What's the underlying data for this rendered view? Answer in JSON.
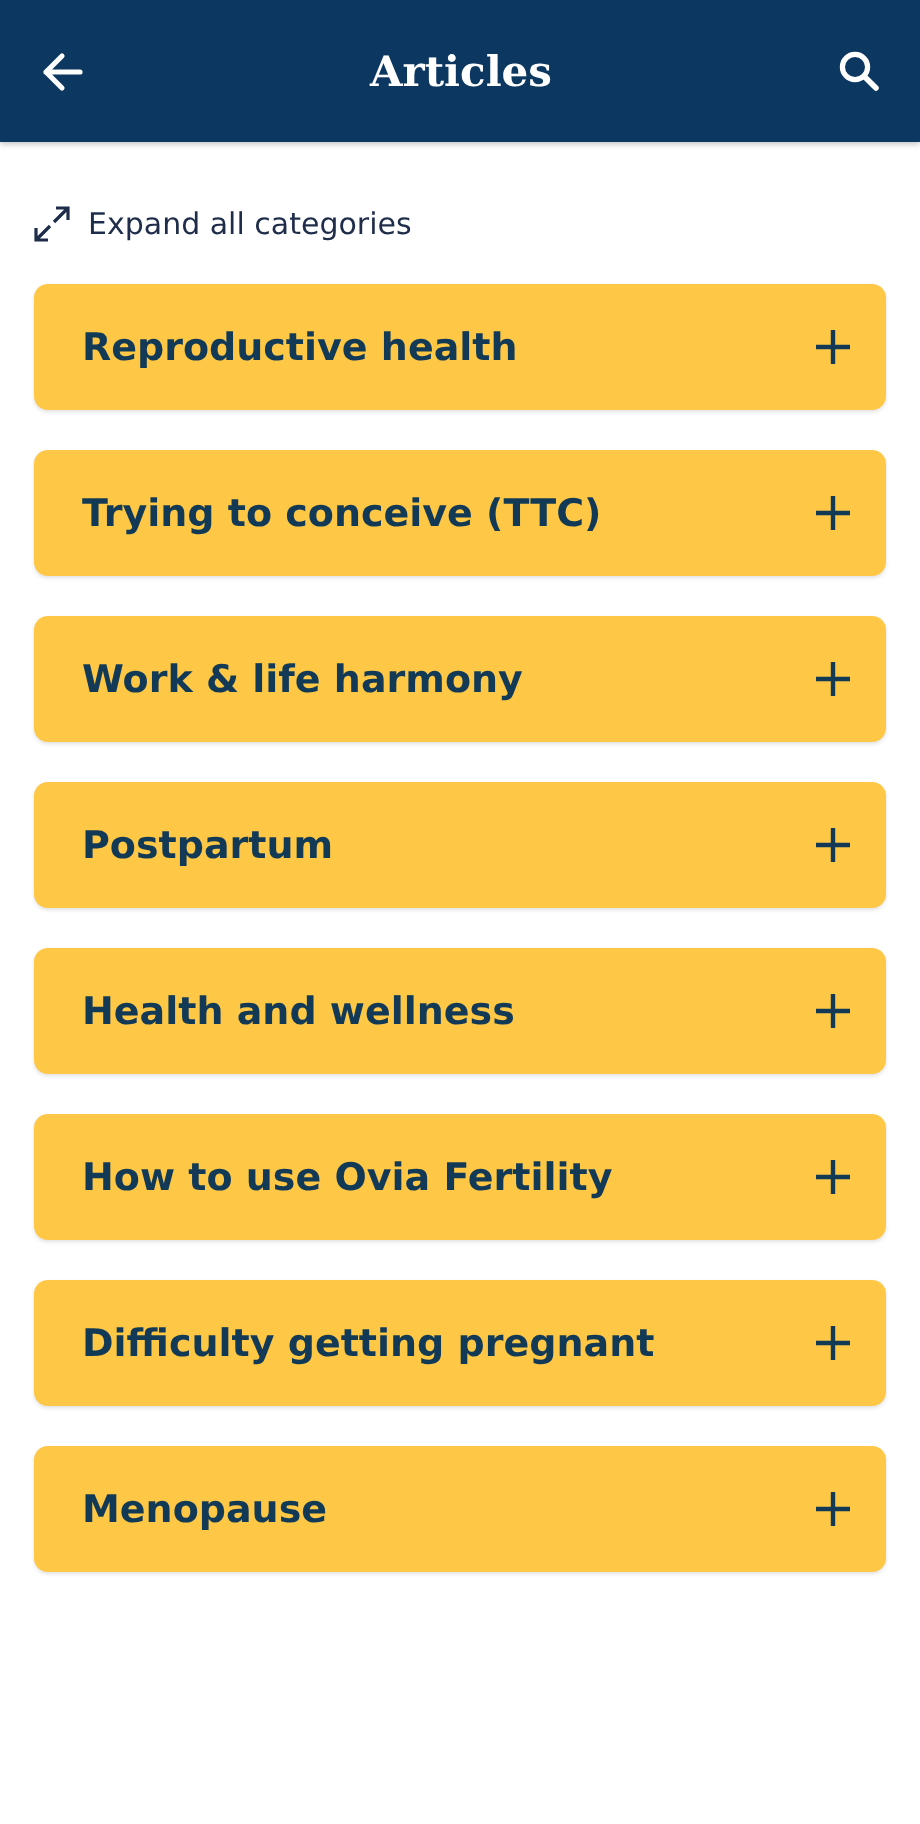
{
  "header": {
    "title": "Articles"
  },
  "expand_all": {
    "label": "Expand all categories"
  },
  "categories": [
    {
      "label": "Reproductive health",
      "expanded": false
    },
    {
      "label": "Trying to conceive (TTC)",
      "expanded": false
    },
    {
      "label": "Work & life harmony",
      "expanded": false
    },
    {
      "label": "Postpartum",
      "expanded": false
    },
    {
      "label": "Health and wellness",
      "expanded": false
    },
    {
      "label": "How to use Ovia Fertility",
      "expanded": false
    },
    {
      "label": "Difficulty getting pregnant",
      "expanded": false
    },
    {
      "label": "Menopause",
      "expanded": false
    }
  ]
}
